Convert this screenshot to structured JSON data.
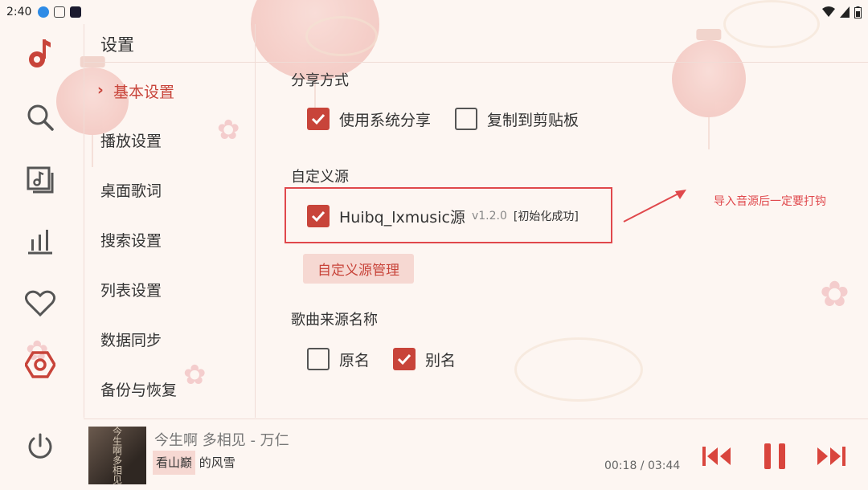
{
  "status_bar": {
    "time": "2:40"
  },
  "page": {
    "title": "设置"
  },
  "nav": {
    "items": [
      {
        "label": "基本设置",
        "active": true
      },
      {
        "label": "播放设置"
      },
      {
        "label": "桌面歌词"
      },
      {
        "label": "搜索设置"
      },
      {
        "label": "列表设置"
      },
      {
        "label": "数据同步"
      },
      {
        "label": "备份与恢复"
      }
    ]
  },
  "rail": {
    "icons": [
      "music-note-icon",
      "search-icon",
      "music-library-icon",
      "chart-bars-icon",
      "heart-icon",
      "settings-hexagon-icon",
      "power-icon"
    ]
  },
  "share": {
    "title": "分享方式",
    "options": [
      {
        "label": "使用系统分享",
        "checked": true
      },
      {
        "label": "复制到剪贴板",
        "checked": false
      }
    ]
  },
  "custom_source": {
    "title": "自定义源",
    "item": {
      "name": "Huibq_lxmusic源",
      "version": "v1.2.0",
      "status": "[初始化成功]",
      "checked": true
    },
    "manage_button": "自定义源管理"
  },
  "source_name": {
    "title": "歌曲来源名称",
    "options": [
      {
        "label": "原名",
        "checked": false
      },
      {
        "label": "别名",
        "checked": true
      }
    ]
  },
  "annotation": {
    "text": "导入音源后一定要打钩"
  },
  "player": {
    "song": "今生啊 多相见 - 万仁",
    "lyric_highlight": "看山巅",
    "lyric_rest": " 的风雪",
    "time": "00:18 / 03:44",
    "cover_text": "今生啊多相见"
  },
  "colors": {
    "accent": "#c8443a",
    "annotation": "#e0484c",
    "background": "#fdf6f2"
  }
}
